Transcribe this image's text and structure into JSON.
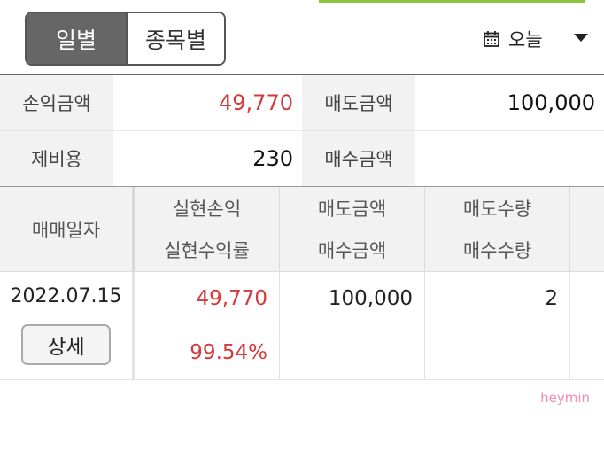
{
  "tabs": {
    "daily": "일별",
    "by_stock": "종목별"
  },
  "period": {
    "label": "오늘",
    "icon": "calendar-icon"
  },
  "summary": {
    "profit_label": "손익금액",
    "profit_value": "49,770",
    "sell_label": "매도금액",
    "sell_value": "100,000",
    "fee_label": "제비용",
    "fee_value": "230",
    "buy_label": "매수금액",
    "buy_value": ""
  },
  "table": {
    "headers": {
      "date": "매매일자",
      "realized_pl": "실현손익",
      "realized_rate": "실현수익률",
      "sell_amount": "매도금액",
      "buy_amount": "매수금액",
      "sell_qty": "매도수량",
      "buy_qty": "매수수량"
    },
    "rows": [
      {
        "date": "2022.07.15",
        "detail": "상세",
        "realized_pl": "49,770",
        "realized_rate": "99.54%",
        "sell_amount": "100,000",
        "buy_amount": "",
        "sell_qty": "2",
        "buy_qty": ""
      }
    ]
  },
  "watermark": "heymin",
  "colors": {
    "accent": "#8cc63f",
    "profit": "#d33a3a",
    "tab_active": "#666666",
    "watermark": "#f08cb4"
  }
}
